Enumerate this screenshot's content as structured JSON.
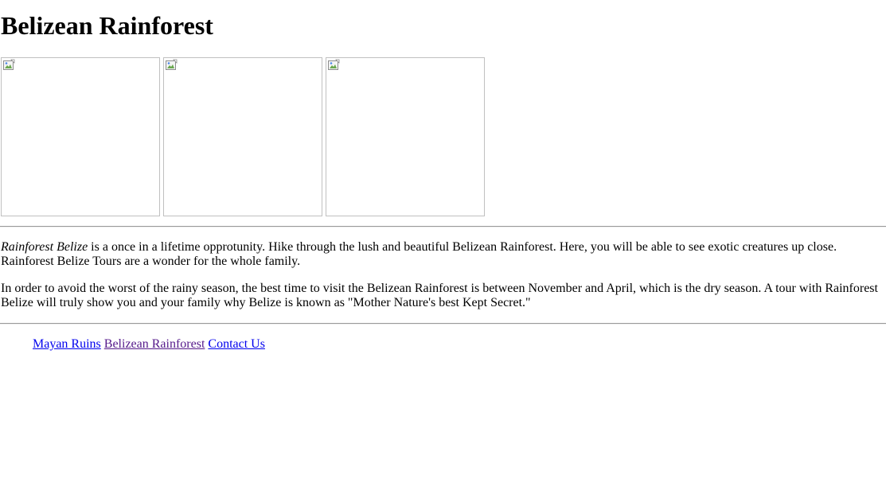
{
  "page": {
    "title": "Belizean Rainforest"
  },
  "gallery": {
    "images": [
      {
        "alt": "",
        "icon": "broken-image-icon"
      },
      {
        "alt": "",
        "icon": "broken-image-icon"
      },
      {
        "alt": "",
        "icon": "broken-image-icon"
      }
    ]
  },
  "content": {
    "para1_em": "Rainforest Belize",
    "para1_rest": " is a once in a lifetime opprotunity. Hike through the lush and beautiful Belizean Rainforest. Here, you will be able to see exotic creatures up close. Rainforest Belize Tours are a wonder for the whole family.",
    "para2": "In order to avoid the worst of the rainy season, the best time to visit the Belizean Rainforest is between November and April, which is the dry season. A tour with Rainforest Belize will truly show you and your family why Belize is known as \"Mother Nature's best Kept Secret.\""
  },
  "nav": {
    "links": [
      {
        "label": "Mayan Ruins",
        "state": "unvisited"
      },
      {
        "label": "Belizean Rainforest",
        "state": "visited"
      },
      {
        "label": "Contact Us",
        "state": "unvisited"
      }
    ]
  },
  "colors": {
    "link_unvisited": "#0000ee",
    "link_visited": "#551a8b",
    "image_border": "#c0c0c0",
    "rule": "#9a9a9a"
  }
}
